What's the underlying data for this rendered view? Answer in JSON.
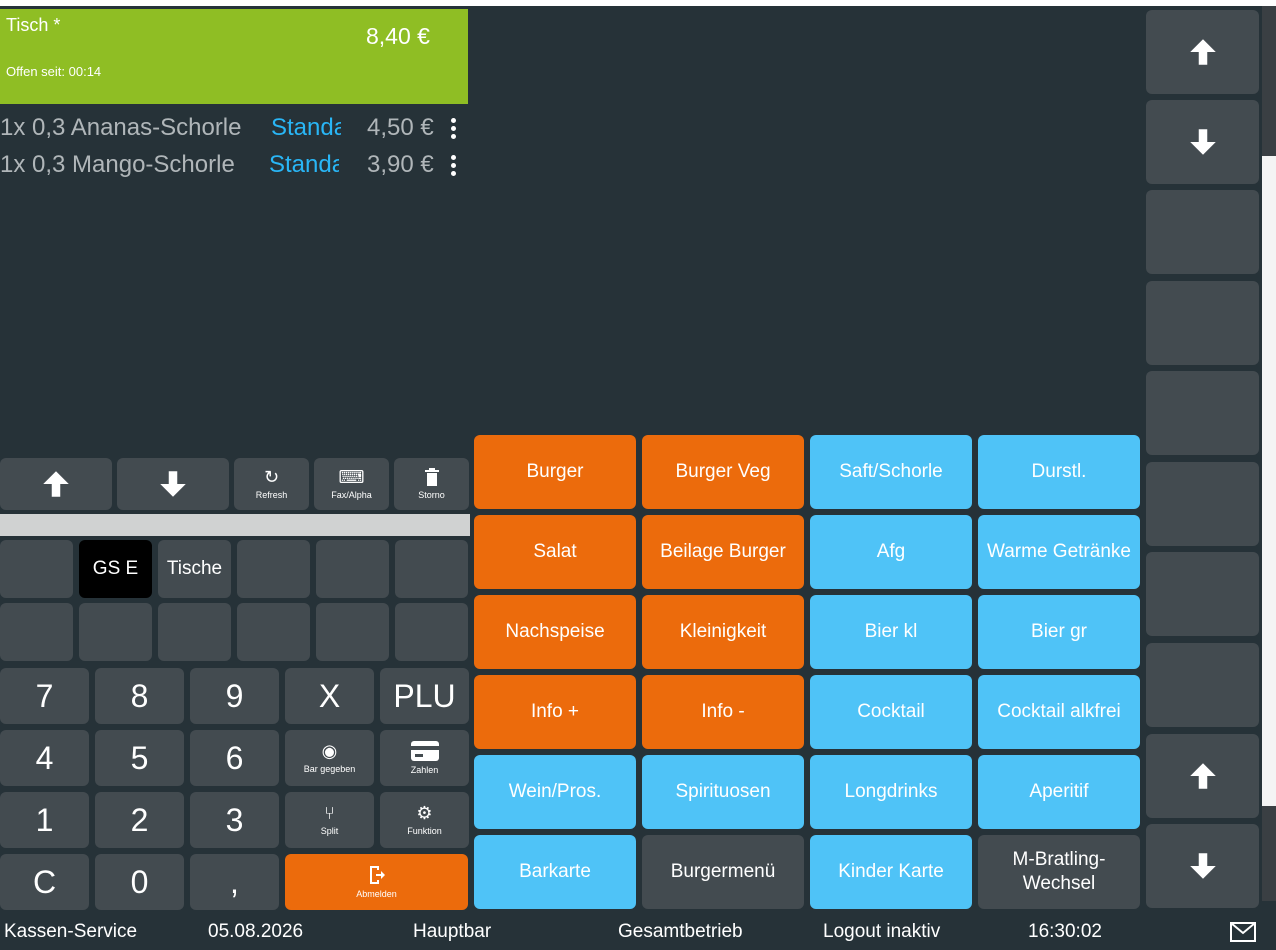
{
  "header": {
    "table": "Tisch *",
    "total": "8,40 €",
    "open_since": "Offen seit: 00:14",
    "color": "#8fbe24"
  },
  "orders": [
    {
      "name": "1x 0,3 Ananas-Schorle",
      "tag": "Standard",
      "price": "4,50 €"
    },
    {
      "name": "1x 0,3 Mango-Schorle",
      "tag": "Standard",
      "price": "3,90 €"
    }
  ],
  "toolbar": {
    "refresh": "Refresh",
    "fax_alpha": "Fax/Alpha",
    "storno": "Storno"
  },
  "quick": {
    "gs_e": "GS E",
    "tische": "Tische"
  },
  "keypad": {
    "k7": "7",
    "k8": "8",
    "k9": "9",
    "x": "X",
    "plu": "PLU",
    "k4": "4",
    "k5": "5",
    "k6": "6",
    "bar_gegeben": "Bar gegeben",
    "zahlen": "Zahlen",
    "k1": "1",
    "k2": "2",
    "k3": "3",
    "split": "Split",
    "funktion": "Funktion",
    "c": "C",
    "k0": "0",
    "comma": ",",
    "abmelden": "Abmelden"
  },
  "categories": [
    [
      "Burger",
      "Burger Veg",
      "Saft/Schorle",
      "Durstl."
    ],
    [
      "Salat",
      "Beilage Burger",
      "Afg",
      "Warme Getränke"
    ],
    [
      "Nachspeise",
      "Kleinigkeit",
      "Bier kl",
      "Bier gr"
    ],
    [
      "Info +",
      "Info -",
      "Cocktail",
      "Cocktail alkfrei"
    ],
    [
      "Wein/Pros.",
      "Spirituosen",
      "Longdrinks",
      "Aperitif"
    ],
    [
      "Barkarte",
      "Burgermenü",
      "Kinder Karte",
      "M-Bratling-Wechsel"
    ]
  ],
  "colors": {
    "orange": "#ec6b0c",
    "blue": "#4fc3f7",
    "dark": "#434b50",
    "background": "#263238"
  },
  "status": {
    "service": "Kassen-Service",
    "date": "05.08.2026",
    "location": "Hauptbar",
    "mode": "Gesamtbetrieb",
    "logout": "Logout inaktiv",
    "time": "16:30:02"
  }
}
